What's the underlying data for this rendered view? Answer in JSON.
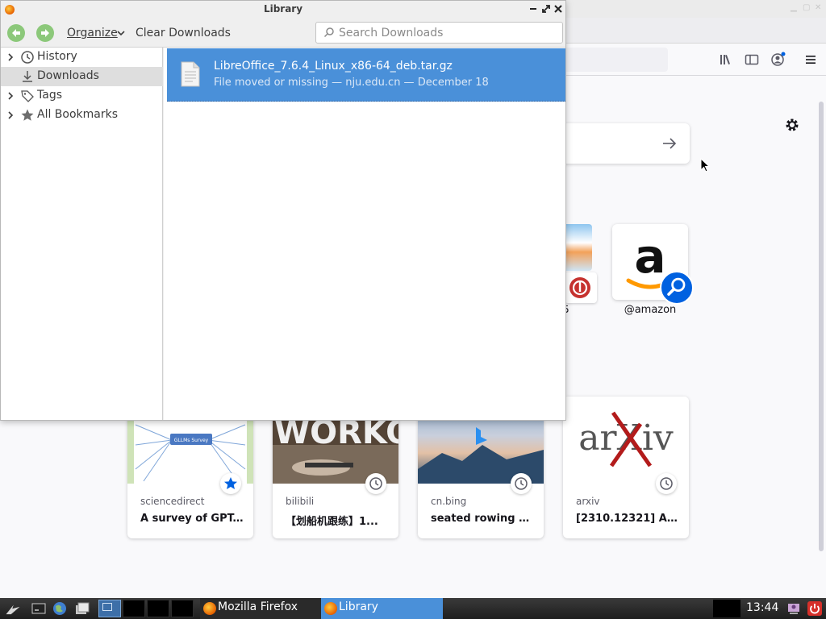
{
  "library": {
    "title": "Library",
    "toolbar": {
      "organize_label": "Organize",
      "clear_label": "Clear Downloads",
      "search_placeholder": "Search Downloads"
    },
    "sidebar": {
      "items": [
        {
          "label": "History",
          "icon": "clock-icon",
          "expandable": true
        },
        {
          "label": "Downloads",
          "icon": "download-icon",
          "expandable": false,
          "selected": true
        },
        {
          "label": "Tags",
          "icon": "tag-icon",
          "expandable": true
        },
        {
          "label": "All Bookmarks",
          "icon": "star-icon",
          "expandable": true
        }
      ]
    },
    "downloads": [
      {
        "name": "LibreOffice_7.6.4_Linux_x86-64_deb.tar.gz",
        "status": "File moved or missing — nju.edu.cn — December 18"
      }
    ]
  },
  "firefox": {
    "top_sites": [
      {
        "label": "5"
      },
      {
        "label": "@amazon"
      }
    ],
    "highlights": [
      {
        "site": "sciencedirect",
        "title": "A survey of GPT...",
        "badge": "bookmark-star-icon"
      },
      {
        "site": "bilibili",
        "title": "【划船机跟练】1...",
        "badge": "history-clock-icon"
      },
      {
        "site": "cn.bing",
        "title": "seated rowing t...",
        "badge": "history-clock-icon"
      },
      {
        "site": "arxiv",
        "title": "[2310.12321] A ...",
        "badge": "history-clock-icon"
      }
    ],
    "thumb_texts": {
      "gllm": "GLLMs Survey",
      "workout": "WORKO",
      "arxiv": "arXiv"
    }
  },
  "taskbar": {
    "tasks": [
      {
        "label": "Mozilla Firefox",
        "active": false
      },
      {
        "label": "Library",
        "active": true
      }
    ],
    "clock": "13:44"
  },
  "colors": {
    "selection": "#4a90d9",
    "accent": "#0061e0",
    "nav_green": "#8cc87a"
  }
}
